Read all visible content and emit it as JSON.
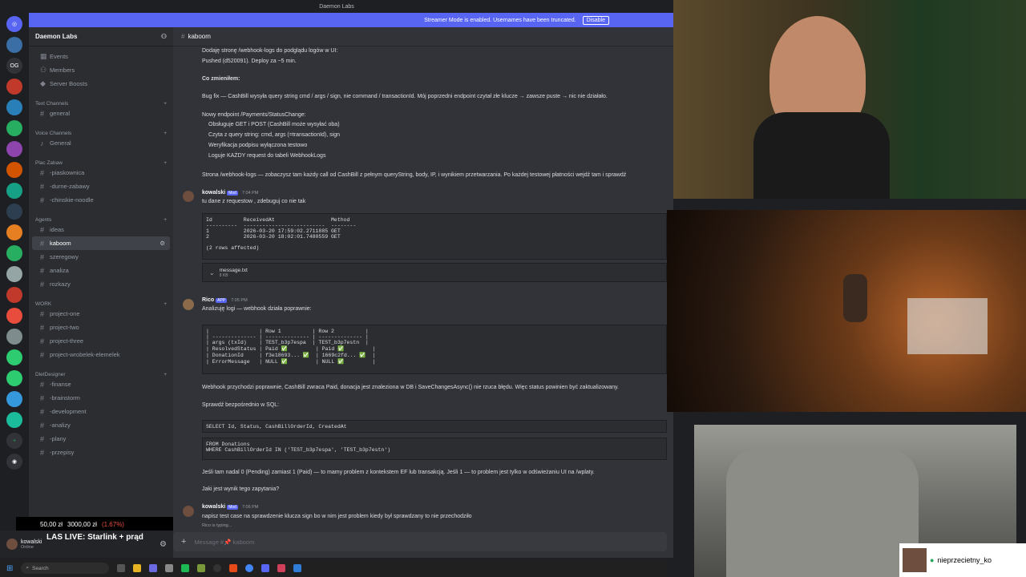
{
  "window": {
    "title": "Daemon Labs"
  },
  "banner": {
    "text": "Streamer Mode is enabled. Usernames have been truncated.",
    "button": "Disable"
  },
  "rail": [
    "OG"
  ],
  "sidebar": {
    "guild": "Daemon Labs",
    "top_items": [
      "Events",
      "Members",
      "Server Boosts"
    ],
    "categories": [
      {
        "name": "Text Channels",
        "channels": [
          "general"
        ]
      },
      {
        "name": "Voice Channels",
        "channels": [
          "General"
        ]
      },
      {
        "name": "Plac Zabaw",
        "channels": [
          "-piaskownica",
          "-durne-zabawy",
          "-chinskie-noodle"
        ]
      },
      {
        "name": "Agents",
        "channels": [
          "ideas",
          "kaboom",
          "szeregowy",
          "analiza",
          "rozkazy"
        ]
      },
      {
        "name": "WORK",
        "channels": [
          "project-one",
          "project-two",
          "project-three",
          "project-wrobelek-elemelek"
        ]
      },
      {
        "name": "DletDesigner",
        "channels": [
          "-finanse",
          "-brainstorm",
          "-development",
          "-analizy",
          "-plany",
          "-przepisy"
        ]
      }
    ],
    "active_channel": "kaboom",
    "user": {
      "name": "kowalski",
      "status": "Online"
    }
  },
  "overlay": {
    "donation": "50,00 zł",
    "goal": "3000,00 zł",
    "percent": "(1.67%)",
    "stream_title": "LAS LIVE: Starlink + prąd"
  },
  "chat": {
    "channel": "kaboom",
    "lines": {
      "l1": "Dodaję stronę /webhook-logs do podglądu logów w UI:",
      "l2": "Pushed (d520091). Deploy za ~5 min.",
      "l3": "Co zmieniłem:",
      "l4": "Bug fix — CashBill wysyła query string cmd / args / sign, nie command / transactionId. Mój poprzedni endpoint czytał złe klucze → zawsze puste → nic nie działało.",
      "l5": "Nowy endpoint /Payments/StatusChange:",
      "b1": "Obsługuje GET i POST (CashBill może wysyłać oba)",
      "b2": "Czyta z query string: cmd, args (=transactionId), sign",
      "b3": "Weryfikacja podpisu wyłączona testowo",
      "b4": "Loguje KAŻDY request do tabeli WebhookLogs",
      "l6": "Strona /webhook-logs — zobaczysz tam każdy call od CashBill z pełnym queryString, body, IP, i wynikiem przetwarzania. Po każdej testowej płatności wejdź tam i sprawdź"
    },
    "msg2": {
      "user": "kowalski",
      "badge": "Mod",
      "time": "7:04 PM",
      "text": "tu dane z requestow , zdebuguj co nie tak"
    },
    "table1": "Id          ReceivedAt                  Method\n----------  --------------------------  --------\n1           2026-03-20 17:59:02.2711885 GET\n2           2026-03-20 18:02:01.7480559 GET\n\n(2 rows affected)",
    "attachment": {
      "name": "message.txt",
      "size": "8 KB"
    },
    "msg3": {
      "user": "Rico",
      "badge": "APP",
      "time": "7:05 PM",
      "text": "Analizuję logi — webhook działa poprawnie:"
    },
    "table2": "|                | Row 1          | Row 2          |\n| -------------- | -------------- | -------------- |\n| args (txId)    | TEST_b3p7espa  | TEST_b3p7estn  |\n| ResolvedStatus | Paid ✅         | Paid ✅         |\n| DonationId     | f3e18693... ✅  | 1669c2fd... ✅  |\n| ErrorMessage   | NULL ✅         | NULL ✅         |",
    "l7": "Webhook przychodzi poprawnie, CashBill zwraca Paid, donacja jest znaleziona w DB i SaveChangesAsync() nie rzuca błędu. Więc status powinien być zaktualizowany.",
    "l8": "Sprawdź bezpośrednio w SQL:",
    "sql1": "SELECT Id, Status, CashBillOrderId, CreatedAt",
    "sql2": "FROM Donations\nWHERE CashBillOrderId IN ('TEST_b3p7espa', 'TEST_b3p7estn')",
    "l9": "Jeśli tam nadal 0 (Pending) zamiast 1 (Paid) — to mamy problem z kontekstem EF lub transakcją. Jeśli 1 — to problem jest tylko w odświeżaniu UI na /wplaty.",
    "l10": "Jaki jest wynik tego zapytania?",
    "msg4": {
      "user": "kowalski",
      "badge": "Mod",
      "time": "7:06 PM",
      "text": "napisz test case na sprawdzenie klucza sign bo w nim jest problem kiedy był sprawdzany to nie przechodziło"
    },
    "typing": "Rico is typing...",
    "composer_placeholder": "Message #📌 kaboom"
  },
  "taskbar": {
    "search": "Search"
  },
  "namecard": {
    "name": "nieprzecietny_ko"
  },
  "colors": {
    "accent": "#5865f2",
    "bg": "#313338",
    "sidebar": "#2b2d31"
  }
}
